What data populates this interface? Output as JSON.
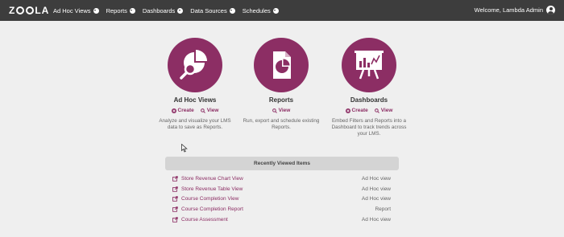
{
  "app": {
    "logo_text": "ZOOLA"
  },
  "nav": {
    "items": [
      {
        "label": "Ad Hoc Views"
      },
      {
        "label": "Reports"
      },
      {
        "label": "Dashboards"
      },
      {
        "label": "Data Sources"
      },
      {
        "label": "Schedules"
      }
    ],
    "welcome": "Welcome, Lambda Admin"
  },
  "tiles": [
    {
      "title": "Ad Hoc Views",
      "create_label": "Create",
      "view_label": "View",
      "description": "Analyze and visualize your LMS data to save as Reports."
    },
    {
      "title": "Reports",
      "view_label": "View",
      "description": "Run, export and schedule existing Reports."
    },
    {
      "title": "Dashboards",
      "create_label": "Create",
      "view_label": "View",
      "description": "Embed Filters and Reports into a Dashboard to track trends across your LMS."
    }
  ],
  "recent": {
    "heading": "Recently Viewed Items",
    "items": [
      {
        "name": "Store Revenue Chart View",
        "type": "Ad Hoc view"
      },
      {
        "name": "Store Revenue Table View",
        "type": "Ad Hoc view"
      },
      {
        "name": "Course Completion View",
        "type": "Ad Hoc view"
      },
      {
        "name": "Course Completion Report",
        "type": "Report"
      },
      {
        "name": "Course Assessment",
        "type": "Ad Hoc view"
      }
    ]
  },
  "colors": {
    "brand": "#8c2e64",
    "topbar": "#3d3d3d",
    "background": "#efefef"
  },
  "icons": {
    "user": "user-circle-icon",
    "create": "plus-circle-icon",
    "view": "search-icon",
    "recent_item": "external-link-icon"
  }
}
